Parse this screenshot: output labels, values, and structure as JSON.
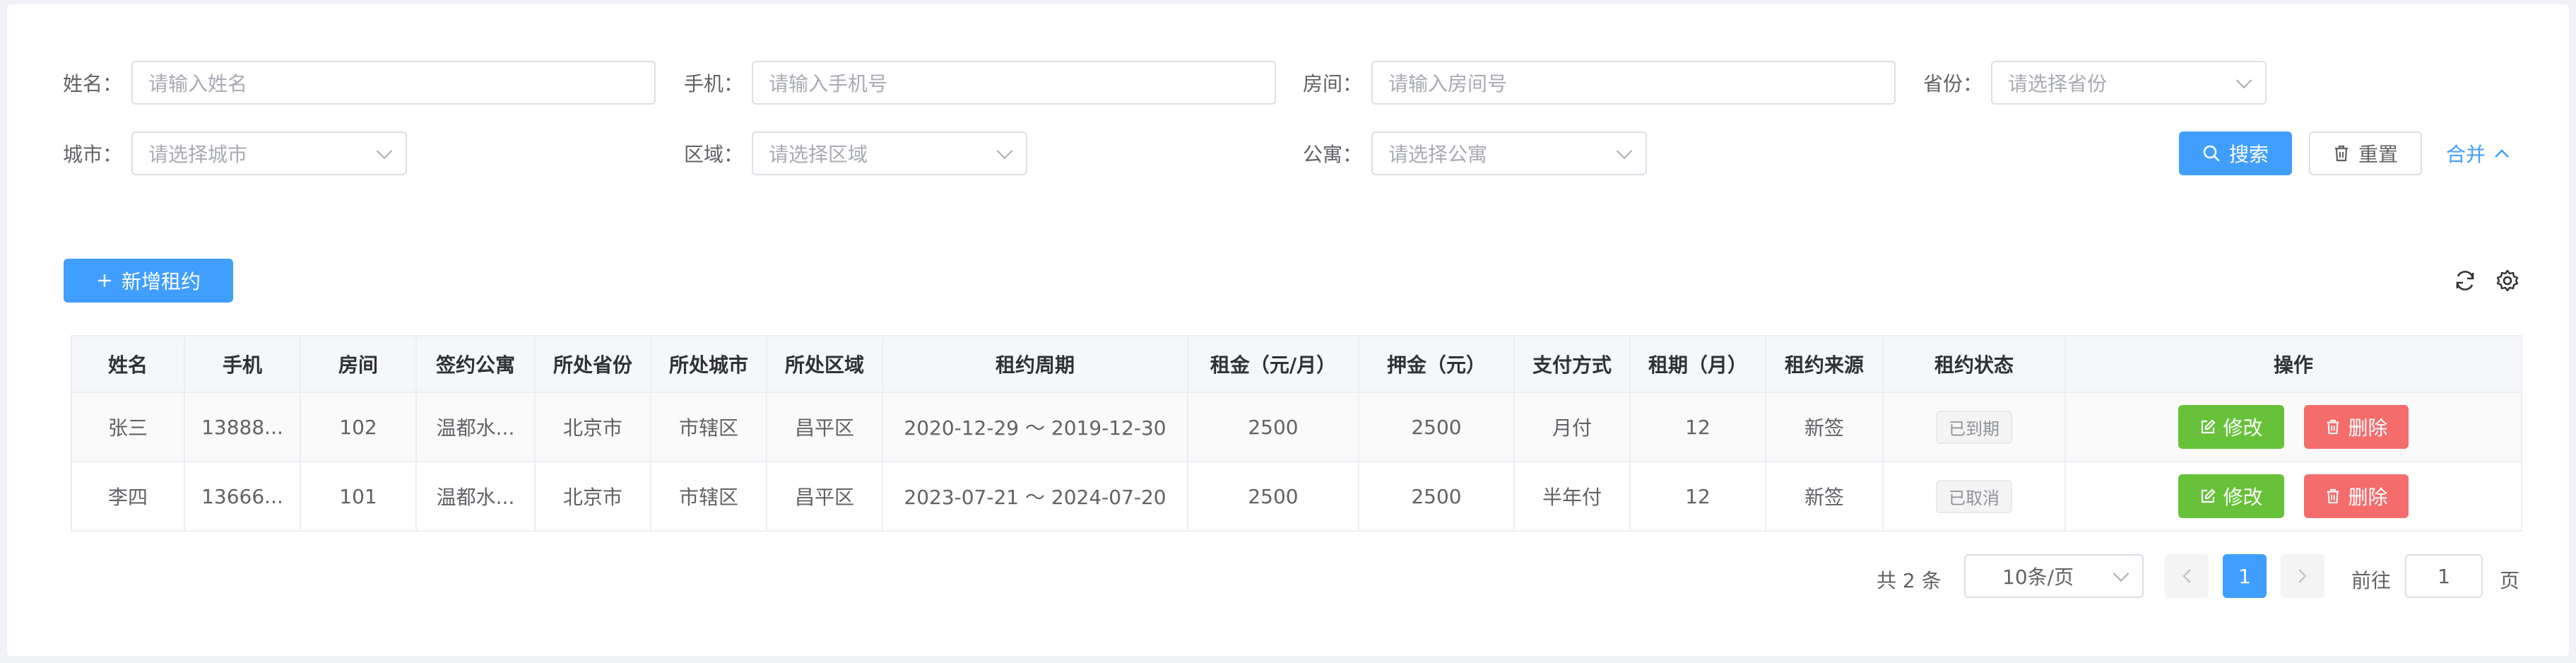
{
  "search": {
    "name": {
      "label": "姓名：",
      "placeholder": "请输入姓名"
    },
    "phone": {
      "label": "手机：",
      "placeholder": "请输入手机号"
    },
    "room": {
      "label": "房间：",
      "placeholder": "请输入房间号"
    },
    "province": {
      "label": "省份：",
      "placeholder": "请选择省份"
    },
    "city": {
      "label": "城市：",
      "placeholder": "请选择城市"
    },
    "district": {
      "label": "区域：",
      "placeholder": "请选择区域"
    },
    "apartment": {
      "label": "公寓：",
      "placeholder": "请选择公寓"
    },
    "search_label": "搜索",
    "reset_label": "重置",
    "collapse_label": "合并"
  },
  "toolbar": {
    "add_label": "新增租约",
    "refresh_icon": "refresh-icon",
    "settings_icon": "gear-icon"
  },
  "table": {
    "headers": [
      "姓名",
      "手机",
      "房间",
      "签约公寓",
      "所处省份",
      "所处城市",
      "所处区域",
      "租约周期",
      "租金（元/月）",
      "押金（元）",
      "支付方式",
      "租期（月）",
      "租约来源",
      "租约状态",
      "操作"
    ],
    "rows": [
      {
        "name": "张三",
        "phone": "13888...",
        "room": "102",
        "apartment": "温都水...",
        "province": "北京市",
        "city": "市辖区",
        "district": "昌平区",
        "period": "2020-12-29 ～ 2019-12-30",
        "rent": "2500",
        "deposit": "2500",
        "payment": "月付",
        "term": "12",
        "source": "新签",
        "status": "已到期"
      },
      {
        "name": "李四",
        "phone": "13666...",
        "room": "101",
        "apartment": "温都水...",
        "province": "北京市",
        "city": "市辖区",
        "district": "昌平区",
        "period": "2023-07-21 ～ 2024-07-20",
        "rent": "2500",
        "deposit": "2500",
        "payment": "半年付",
        "term": "12",
        "source": "新签",
        "status": "已取消"
      }
    ],
    "edit_label": "修改",
    "delete_label": "删除"
  },
  "pagination": {
    "total": "共 2 条",
    "page_size": "10条/页",
    "current_page": "1",
    "goto_label": "前往",
    "goto_value": "1",
    "page_suffix": "页"
  },
  "colors": {
    "primary": "#409eff",
    "success": "#67c23a",
    "danger": "#f56c6c"
  }
}
